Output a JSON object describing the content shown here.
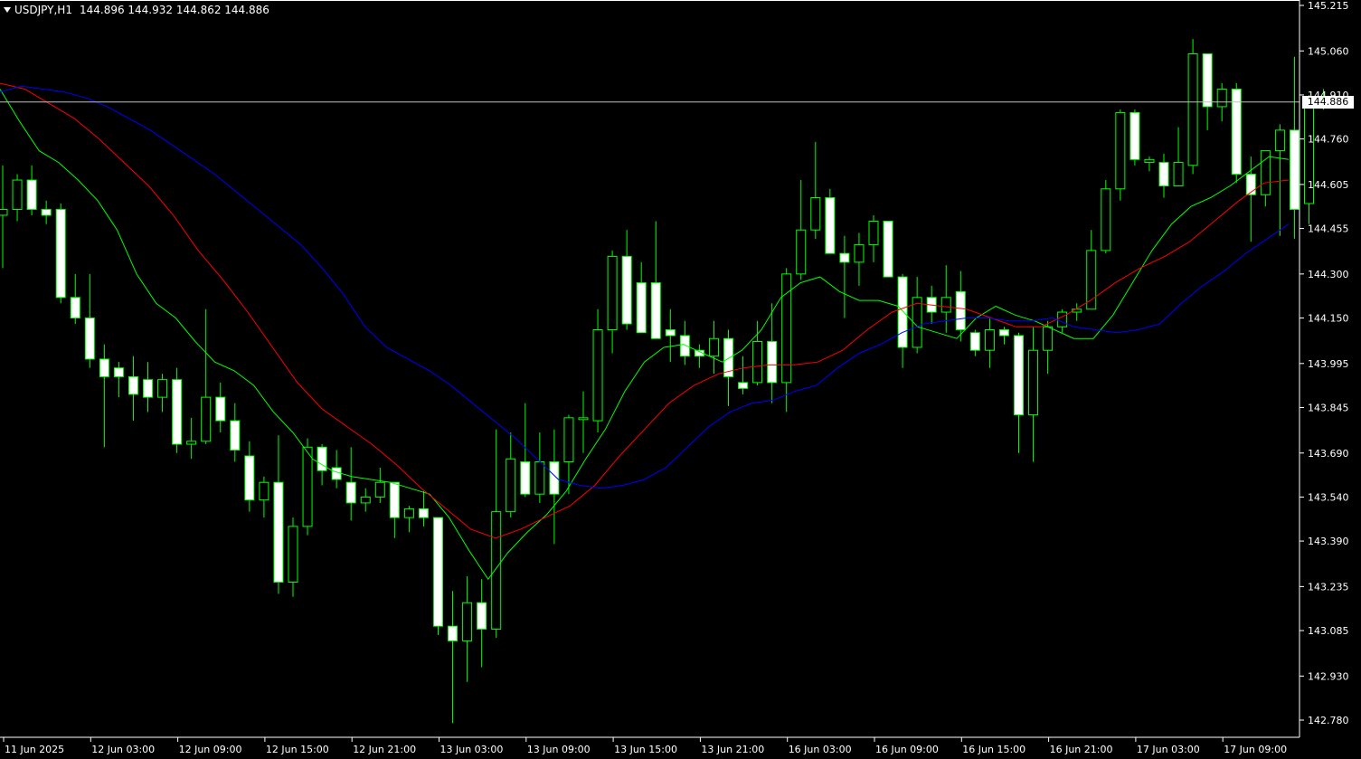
{
  "header": {
    "symbol": "USDJPY,H1",
    "ohlc": "144.896 144.932 144.862 144.886"
  },
  "colors": {
    "background": "#000000",
    "candle_outline": "#00ff00",
    "candle_bull_fill": "#000000",
    "candle_bear_fill": "#ffffff",
    "ma_fast": "#00ff00",
    "ma_mid": "#ff0000",
    "ma_slow": "#0000ff",
    "axis": "#ffffff",
    "price_line": "#c0c0c0"
  },
  "chart_data": {
    "type": "candlestick",
    "current_price": "144.886",
    "ylim": [
      142.73,
      145.215
    ],
    "y_ticks": [
      "145.215",
      "145.060",
      "144.910",
      "144.760",
      "144.605",
      "144.455",
      "144.300",
      "144.150",
      "143.995",
      "143.845",
      "143.690",
      "143.540",
      "143.390",
      "143.235",
      "143.085",
      "142.930",
      "142.780"
    ],
    "x_ticks": [
      "11 Jun 2025",
      "12 Jun 03:00",
      "12 Jun 09:00",
      "12 Jun 15:00",
      "12 Jun 21:00",
      "13 Jun 03:00",
      "13 Jun 09:00",
      "13 Jun 15:00",
      "13 Jun 21:00",
      "16 Jun 03:00",
      "16 Jun 09:00",
      "16 Jun 15:00",
      "16 Jun 21:00",
      "17 Jun 03:00",
      "17 Jun 09:00"
    ],
    "candles": [
      {
        "o": 144.5,
        "h": 144.67,
        "l": 144.32,
        "c": 144.52
      },
      {
        "o": 144.52,
        "h": 144.64,
        "l": 144.48,
        "c": 144.62
      },
      {
        "o": 144.62,
        "h": 144.67,
        "l": 144.5,
        "c": 144.52
      },
      {
        "o": 144.52,
        "h": 144.55,
        "l": 144.47,
        "c": 144.5
      },
      {
        "o": 144.52,
        "h": 144.54,
        "l": 144.2,
        "c": 144.22
      },
      {
        "o": 144.22,
        "h": 144.3,
        "l": 144.13,
        "c": 144.15
      },
      {
        "o": 144.15,
        "h": 144.3,
        "l": 143.98,
        "c": 144.01
      },
      {
        "o": 144.01,
        "h": 144.06,
        "l": 143.71,
        "c": 143.95
      },
      {
        "o": 143.98,
        "h": 144.0,
        "l": 143.88,
        "c": 143.95
      },
      {
        "o": 143.95,
        "h": 144.02,
        "l": 143.8,
        "c": 143.89
      },
      {
        "o": 143.94,
        "h": 144.0,
        "l": 143.83,
        "c": 143.88
      },
      {
        "o": 143.88,
        "h": 143.96,
        "l": 143.83,
        "c": 143.94
      },
      {
        "o": 143.94,
        "h": 143.98,
        "l": 143.69,
        "c": 143.72
      },
      {
        "o": 143.72,
        "h": 143.81,
        "l": 143.67,
        "c": 143.73
      },
      {
        "o": 143.73,
        "h": 144.18,
        "l": 143.72,
        "c": 143.88
      },
      {
        "o": 143.88,
        "h": 143.93,
        "l": 143.76,
        "c": 143.8
      },
      {
        "o": 143.8,
        "h": 143.86,
        "l": 143.66,
        "c": 143.7
      },
      {
        "o": 143.68,
        "h": 143.73,
        "l": 143.49,
        "c": 143.53
      },
      {
        "o": 143.53,
        "h": 143.61,
        "l": 143.47,
        "c": 143.59
      },
      {
        "o": 143.59,
        "h": 143.75,
        "l": 143.21,
        "c": 143.25
      },
      {
        "o": 143.25,
        "h": 143.47,
        "l": 143.2,
        "c": 143.44
      },
      {
        "o": 143.44,
        "h": 143.74,
        "l": 143.41,
        "c": 143.71
      },
      {
        "o": 143.71,
        "h": 143.72,
        "l": 143.58,
        "c": 143.63
      },
      {
        "o": 143.64,
        "h": 143.7,
        "l": 143.57,
        "c": 143.6
      },
      {
        "o": 143.59,
        "h": 143.71,
        "l": 143.46,
        "c": 143.52
      },
      {
        "o": 143.52,
        "h": 143.57,
        "l": 143.49,
        "c": 143.54
      },
      {
        "o": 143.54,
        "h": 143.64,
        "l": 143.52,
        "c": 143.59
      },
      {
        "o": 143.59,
        "h": 143.59,
        "l": 143.4,
        "c": 143.47
      },
      {
        "o": 143.47,
        "h": 143.51,
        "l": 143.42,
        "c": 143.5
      },
      {
        "o": 143.5,
        "h": 143.56,
        "l": 143.44,
        "c": 143.47
      },
      {
        "o": 143.47,
        "h": 143.47,
        "l": 143.07,
        "c": 143.1
      },
      {
        "o": 143.1,
        "h": 143.22,
        "l": 142.77,
        "c": 143.05
      },
      {
        "o": 143.05,
        "h": 143.27,
        "l": 142.91,
        "c": 143.18
      },
      {
        "o": 143.18,
        "h": 143.26,
        "l": 142.96,
        "c": 143.09
      },
      {
        "o": 143.09,
        "h": 143.77,
        "l": 143.06,
        "c": 143.49
      },
      {
        "o": 143.49,
        "h": 143.76,
        "l": 143.47,
        "c": 143.67
      },
      {
        "o": 143.66,
        "h": 143.86,
        "l": 143.54,
        "c": 143.55
      },
      {
        "o": 143.55,
        "h": 143.76,
        "l": 143.52,
        "c": 143.66
      },
      {
        "o": 143.66,
        "h": 143.77,
        "l": 143.38,
        "c": 143.55
      },
      {
        "o": 143.66,
        "h": 143.82,
        "l": 143.55,
        "c": 143.81
      },
      {
        "o": 143.81,
        "h": 143.9,
        "l": 143.69,
        "c": 143.81
      },
      {
        "o": 143.8,
        "h": 144.18,
        "l": 143.76,
        "c": 144.11
      },
      {
        "o": 144.11,
        "h": 144.38,
        "l": 144.03,
        "c": 144.36
      },
      {
        "o": 144.36,
        "h": 144.45,
        "l": 144.11,
        "c": 144.13
      },
      {
        "o": 144.27,
        "h": 144.34,
        "l": 144.1,
        "c": 144.1
      },
      {
        "o": 144.27,
        "h": 144.48,
        "l": 144.08,
        "c": 144.08
      },
      {
        "o": 144.11,
        "h": 144.18,
        "l": 144.0,
        "c": 144.09
      },
      {
        "o": 144.09,
        "h": 144.14,
        "l": 143.99,
        "c": 144.02
      },
      {
        "o": 144.04,
        "h": 144.06,
        "l": 143.98,
        "c": 144.02
      },
      {
        "o": 144.02,
        "h": 144.14,
        "l": 143.96,
        "c": 144.08
      },
      {
        "o": 144.08,
        "h": 144.11,
        "l": 143.85,
        "c": 143.95
      },
      {
        "o": 143.93,
        "h": 144.02,
        "l": 143.89,
        "c": 143.91
      },
      {
        "o": 143.93,
        "h": 144.14,
        "l": 143.92,
        "c": 144.07
      },
      {
        "o": 144.07,
        "h": 144.2,
        "l": 143.86,
        "c": 143.93
      },
      {
        "o": 143.93,
        "h": 144.32,
        "l": 143.83,
        "c": 144.3
      },
      {
        "o": 144.3,
        "h": 144.62,
        "l": 144.28,
        "c": 144.45
      },
      {
        "o": 144.45,
        "h": 144.75,
        "l": 144.42,
        "c": 144.56
      },
      {
        "o": 144.56,
        "h": 144.59,
        "l": 144.37,
        "c": 144.37
      },
      {
        "o": 144.37,
        "h": 144.43,
        "l": 144.15,
        "c": 144.34
      },
      {
        "o": 144.34,
        "h": 144.44,
        "l": 144.26,
        "c": 144.4
      },
      {
        "o": 144.4,
        "h": 144.5,
        "l": 144.34,
        "c": 144.48
      },
      {
        "o": 144.48,
        "h": 144.48,
        "l": 144.29,
        "c": 144.29
      },
      {
        "o": 144.29,
        "h": 144.3,
        "l": 143.98,
        "c": 144.05
      },
      {
        "o": 144.05,
        "h": 144.29,
        "l": 144.03,
        "c": 144.22
      },
      {
        "o": 144.22,
        "h": 144.26,
        "l": 144.13,
        "c": 144.17
      },
      {
        "o": 144.17,
        "h": 144.33,
        "l": 144.1,
        "c": 144.22
      },
      {
        "o": 144.24,
        "h": 144.31,
        "l": 144.07,
        "c": 144.11
      },
      {
        "o": 144.1,
        "h": 144.11,
        "l": 144.02,
        "c": 144.04
      },
      {
        "o": 144.04,
        "h": 144.15,
        "l": 143.98,
        "c": 144.11
      },
      {
        "o": 144.11,
        "h": 144.12,
        "l": 144.06,
        "c": 144.09
      },
      {
        "o": 144.09,
        "h": 144.1,
        "l": 143.69,
        "c": 143.82
      },
      {
        "o": 143.82,
        "h": 144.12,
        "l": 143.66,
        "c": 144.04
      },
      {
        "o": 144.04,
        "h": 144.14,
        "l": 143.96,
        "c": 144.12
      },
      {
        "o": 144.12,
        "h": 144.18,
        "l": 144.1,
        "c": 144.17
      },
      {
        "o": 144.17,
        "h": 144.2,
        "l": 144.14,
        "c": 144.18
      },
      {
        "o": 144.18,
        "h": 144.45,
        "l": 144.18,
        "c": 144.38
      },
      {
        "o": 144.38,
        "h": 144.62,
        "l": 144.37,
        "c": 144.59
      },
      {
        "o": 144.59,
        "h": 144.86,
        "l": 144.55,
        "c": 144.85
      },
      {
        "o": 144.85,
        "h": 144.86,
        "l": 144.67,
        "c": 144.69
      },
      {
        "o": 144.68,
        "h": 144.7,
        "l": 144.65,
        "c": 144.69
      },
      {
        "o": 144.68,
        "h": 144.71,
        "l": 144.56,
        "c": 144.6
      },
      {
        "o": 144.6,
        "h": 144.8,
        "l": 144.6,
        "c": 144.68
      },
      {
        "o": 144.67,
        "h": 145.1,
        "l": 144.64,
        "c": 145.05
      },
      {
        "o": 145.05,
        "h": 145.05,
        "l": 144.79,
        "c": 144.87
      },
      {
        "o": 144.87,
        "h": 144.95,
        "l": 144.82,
        "c": 144.93
      },
      {
        "o": 144.93,
        "h": 144.95,
        "l": 144.61,
        "c": 144.64
      },
      {
        "o": 144.64,
        "h": 144.7,
        "l": 144.41,
        "c": 144.57
      },
      {
        "o": 144.57,
        "h": 144.72,
        "l": 144.53,
        "c": 144.72
      },
      {
        "o": 144.72,
        "h": 144.81,
        "l": 144.43,
        "c": 144.79
      },
      {
        "o": 144.79,
        "h": 145.04,
        "l": 144.42,
        "c": 144.52
      },
      {
        "o": 144.54,
        "h": 144.91,
        "l": 144.47,
        "c": 144.89
      },
      {
        "o": 144.89,
        "h": 144.93,
        "l": 144.86,
        "c": 144.886
      }
    ],
    "ma_fast": [
      144.93,
      144.82,
      144.72,
      144.68,
      144.62,
      144.55,
      144.45,
      144.3,
      144.2,
      144.15,
      144.07,
      144.0,
      143.97,
      143.92,
      143.83,
      143.76,
      143.67,
      143.63,
      143.61,
      143.6,
      143.59,
      143.57,
      143.55,
      143.47,
      143.36,
      143.26,
      143.35,
      143.42,
      143.48,
      143.56,
      143.67,
      143.77,
      143.9,
      144.0,
      144.05,
      144.06,
      144.03,
      144.0,
      144.04,
      144.11,
      144.22,
      144.27,
      144.29,
      144.24,
      144.21,
      144.21,
      144.19,
      144.12,
      144.1,
      144.08,
      144.15,
      144.19,
      144.16,
      144.14,
      144.11,
      144.08,
      144.08,
      144.16,
      144.27,
      144.38,
      144.47,
      144.53,
      144.56,
      144.6,
      144.65,
      144.7,
      144.69
    ],
    "ma_mid": [
      144.95,
      144.93,
      144.88,
      144.83,
      144.76,
      144.68,
      144.6,
      144.5,
      144.38,
      144.28,
      144.17,
      144.05,
      143.93,
      143.84,
      143.78,
      143.72,
      143.65,
      143.57,
      143.5,
      143.43,
      143.4,
      143.43,
      143.47,
      143.51,
      143.58,
      143.68,
      143.77,
      143.86,
      143.92,
      143.96,
      143.98,
      143.99,
      143.99,
      144.0,
      144.04,
      144.11,
      144.17,
      144.2,
      144.19,
      144.18,
      144.15,
      144.12,
      144.12,
      144.16,
      144.21,
      144.27,
      144.32,
      144.36,
      144.41,
      144.48,
      144.55,
      144.61,
      144.62
    ],
    "ma_slow": [
      144.92,
      144.94,
      144.93,
      144.92,
      144.9,
      144.87,
      144.83,
      144.79,
      144.74,
      144.69,
      144.64,
      144.58,
      144.52,
      144.46,
      144.4,
      144.32,
      144.23,
      144.12,
      144.05,
      144.01,
      143.97,
      143.92,
      143.86,
      143.8,
      143.74,
      143.67,
      143.6,
      143.58,
      143.57,
      143.58,
      143.6,
      143.64,
      143.71,
      143.78,
      143.83,
      143.86,
      143.87,
      143.9,
      143.92,
      143.98,
      144.03,
      144.06,
      144.1,
      144.13,
      144.14,
      144.15,
      144.15,
      144.14,
      144.14,
      144.15,
      144.12,
      144.11,
      144.1,
      144.11,
      144.13,
      144.2,
      144.26,
      144.31,
      144.37,
      144.42,
      144.47
    ]
  }
}
